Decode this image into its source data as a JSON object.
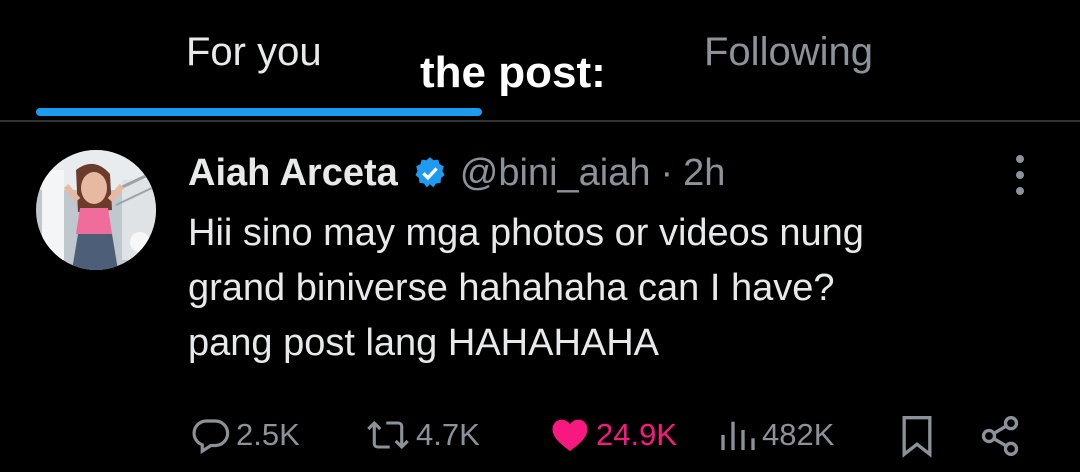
{
  "tabs": [
    {
      "label": "For you",
      "selected": true
    },
    {
      "label": "Following",
      "selected": false
    }
  ],
  "caption": "the post:",
  "post": {
    "author_name": "Aiah Arceta",
    "verified": true,
    "handle": "@bini_aiah",
    "separator": "·",
    "time": "2h",
    "text_lines": [
      "Hii sino may mga photos or videos nung",
      "grand biniverse hahahaha can I have?",
      "pang post lang HAHAHAHA"
    ]
  },
  "actions": {
    "replies": "2.5K",
    "reposts": "4.7K",
    "likes": "24.9K",
    "liked": true,
    "views": "482K"
  },
  "colors": {
    "accent": "#1d9bf0",
    "like": "#f91880",
    "muted": "#8b9299",
    "text": "#e7e9ea",
    "background": "#000000"
  },
  "icons": [
    "reply-icon",
    "repost-icon",
    "heart-icon",
    "views-icon",
    "bookmark-icon",
    "share-icon",
    "more-icon",
    "verified-badge-icon"
  ]
}
